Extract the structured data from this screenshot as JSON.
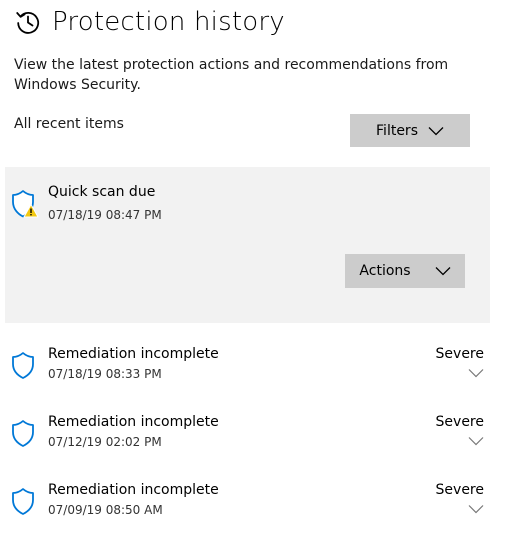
{
  "header": {
    "title": "Protection history",
    "icon": "history-icon"
  },
  "description": "View the latest protection actions and recommendations from Windows Security.",
  "list": {
    "heading": "All recent items",
    "filters_label": "Filters"
  },
  "expanded_item": {
    "title": "Quick scan due",
    "time": "07/18/19 08:47 PM",
    "icon": "shield-warning-icon",
    "actions_label": "Actions"
  },
  "items": [
    {
      "title": "Remediation incomplete",
      "time": "07/18/19 08:33 PM",
      "severity": "Severe",
      "icon": "shield-icon"
    },
    {
      "title": "Remediation incomplete",
      "time": "07/12/19 02:02 PM",
      "severity": "Severe",
      "icon": "shield-icon"
    },
    {
      "title": "Remediation incomplete",
      "time": "07/09/19 08:50 AM",
      "severity": "Severe",
      "icon": "shield-icon"
    }
  ],
  "colors": {
    "accent": "#0078d7",
    "warning": "#f2c811",
    "button_bg": "#cccccc",
    "panel_bg": "#f2f2f2"
  }
}
